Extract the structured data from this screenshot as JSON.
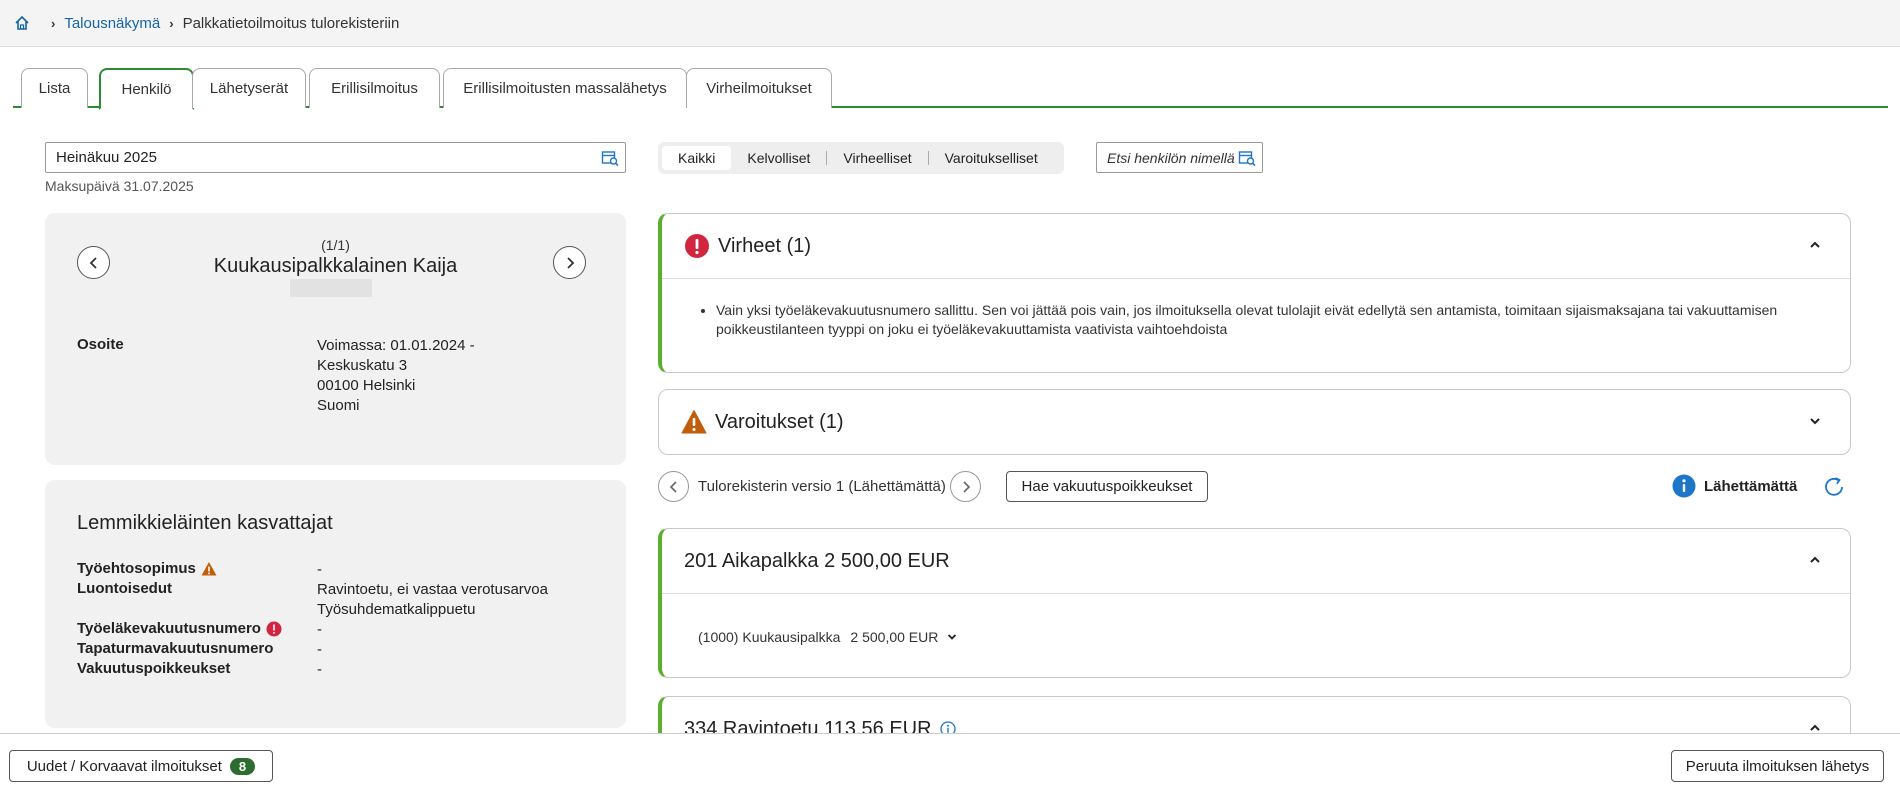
{
  "breadcrumb": {
    "home_icon": "home-icon",
    "items": [
      "Talousnäkymä",
      "Palkkatietoilmoitus tulorekisteriin"
    ]
  },
  "tabs": [
    "Lista",
    "Henkilö",
    "Lähetyserät",
    "Erillisilmoitus",
    "Erillisilmoitusten massalähetys",
    "Virheilmoitukset"
  ],
  "active_tab": "Henkilö",
  "period": {
    "value": "Heinäkuu 2025",
    "paydate": "Maksupäivä 31.07.2025"
  },
  "person": {
    "count": "(1/1)",
    "name": "Kuukausipalkkalainen Kaija",
    "address_label": "Osoite",
    "address_lines": [
      "Voimassa: 01.01.2024 -",
      "Keskuskatu 3",
      "00100 Helsinki",
      "Suomi"
    ]
  },
  "organization": {
    "title": "Lemmikkieläinten kasvattajat",
    "rows": [
      {
        "label": "Työehtosopimus",
        "icon": "warning-icon",
        "values": [
          "-"
        ]
      },
      {
        "label": "Luontoisedut",
        "icon": "",
        "values": [
          "Ravintoetu, ei vastaa verotusarvoa",
          "Työsuhdematkalippuetu"
        ]
      },
      {
        "label": "Työeläkevakuutusnumero",
        "icon": "error-icon",
        "values": [
          "-"
        ]
      },
      {
        "label": "Tapaturmavakuutusnumero",
        "icon": "",
        "values": [
          "-"
        ]
      },
      {
        "label": "Vakuutuspoikkeukset",
        "icon": "",
        "values": [
          "-"
        ]
      }
    ]
  },
  "filters": {
    "options": [
      "Kaikki",
      "Kelvolliset",
      "Virheelliset",
      "Varoitukselliset"
    ],
    "selected": "Kaikki"
  },
  "search": {
    "label": "Etsi henkilön nimellä"
  },
  "errors": {
    "title": "Virheet (1)",
    "items": [
      "Vain yksi työeläkevakuutusnumero sallittu. Sen voi jättää pois vain, jos ilmoituksella olevat tulolajit eivät edellytä sen antamista, toimitaan sijaismaksajana tai vakuuttamisen poikkeustilanteen tyyppi on joku ei työeläkevakuuttamista vaativista vaihtoehdoista"
    ]
  },
  "warnings": {
    "title": "Varoitukset (1)"
  },
  "version": {
    "text": "Tulorekisterin versio 1 (Lähettämättä)",
    "fetch_button": "Hae vakuutuspoikkeukset",
    "status": "Lähettämättä"
  },
  "income": [
    {
      "title": "201 Aikapalkka 2 500,00 EUR",
      "sub": "(1000) Kuukausipalkka",
      "sub_amount": "2 500,00 EUR"
    },
    {
      "title": "334 Ravintoetu 113,56 EUR"
    }
  ],
  "bottom": {
    "new_button": "Uudet / Korvaavat ilmoitukset",
    "new_count": "8",
    "cancel_button": "Peruuta ilmoituksen lähetys"
  },
  "colors": {
    "accent_green": "#2e8b33",
    "panel_green": "#5ab02d",
    "error_red": "#d0263f",
    "warning_orange": "#c25e0a",
    "info_blue": "#1d76c8",
    "link_blue": "#1565a8"
  }
}
